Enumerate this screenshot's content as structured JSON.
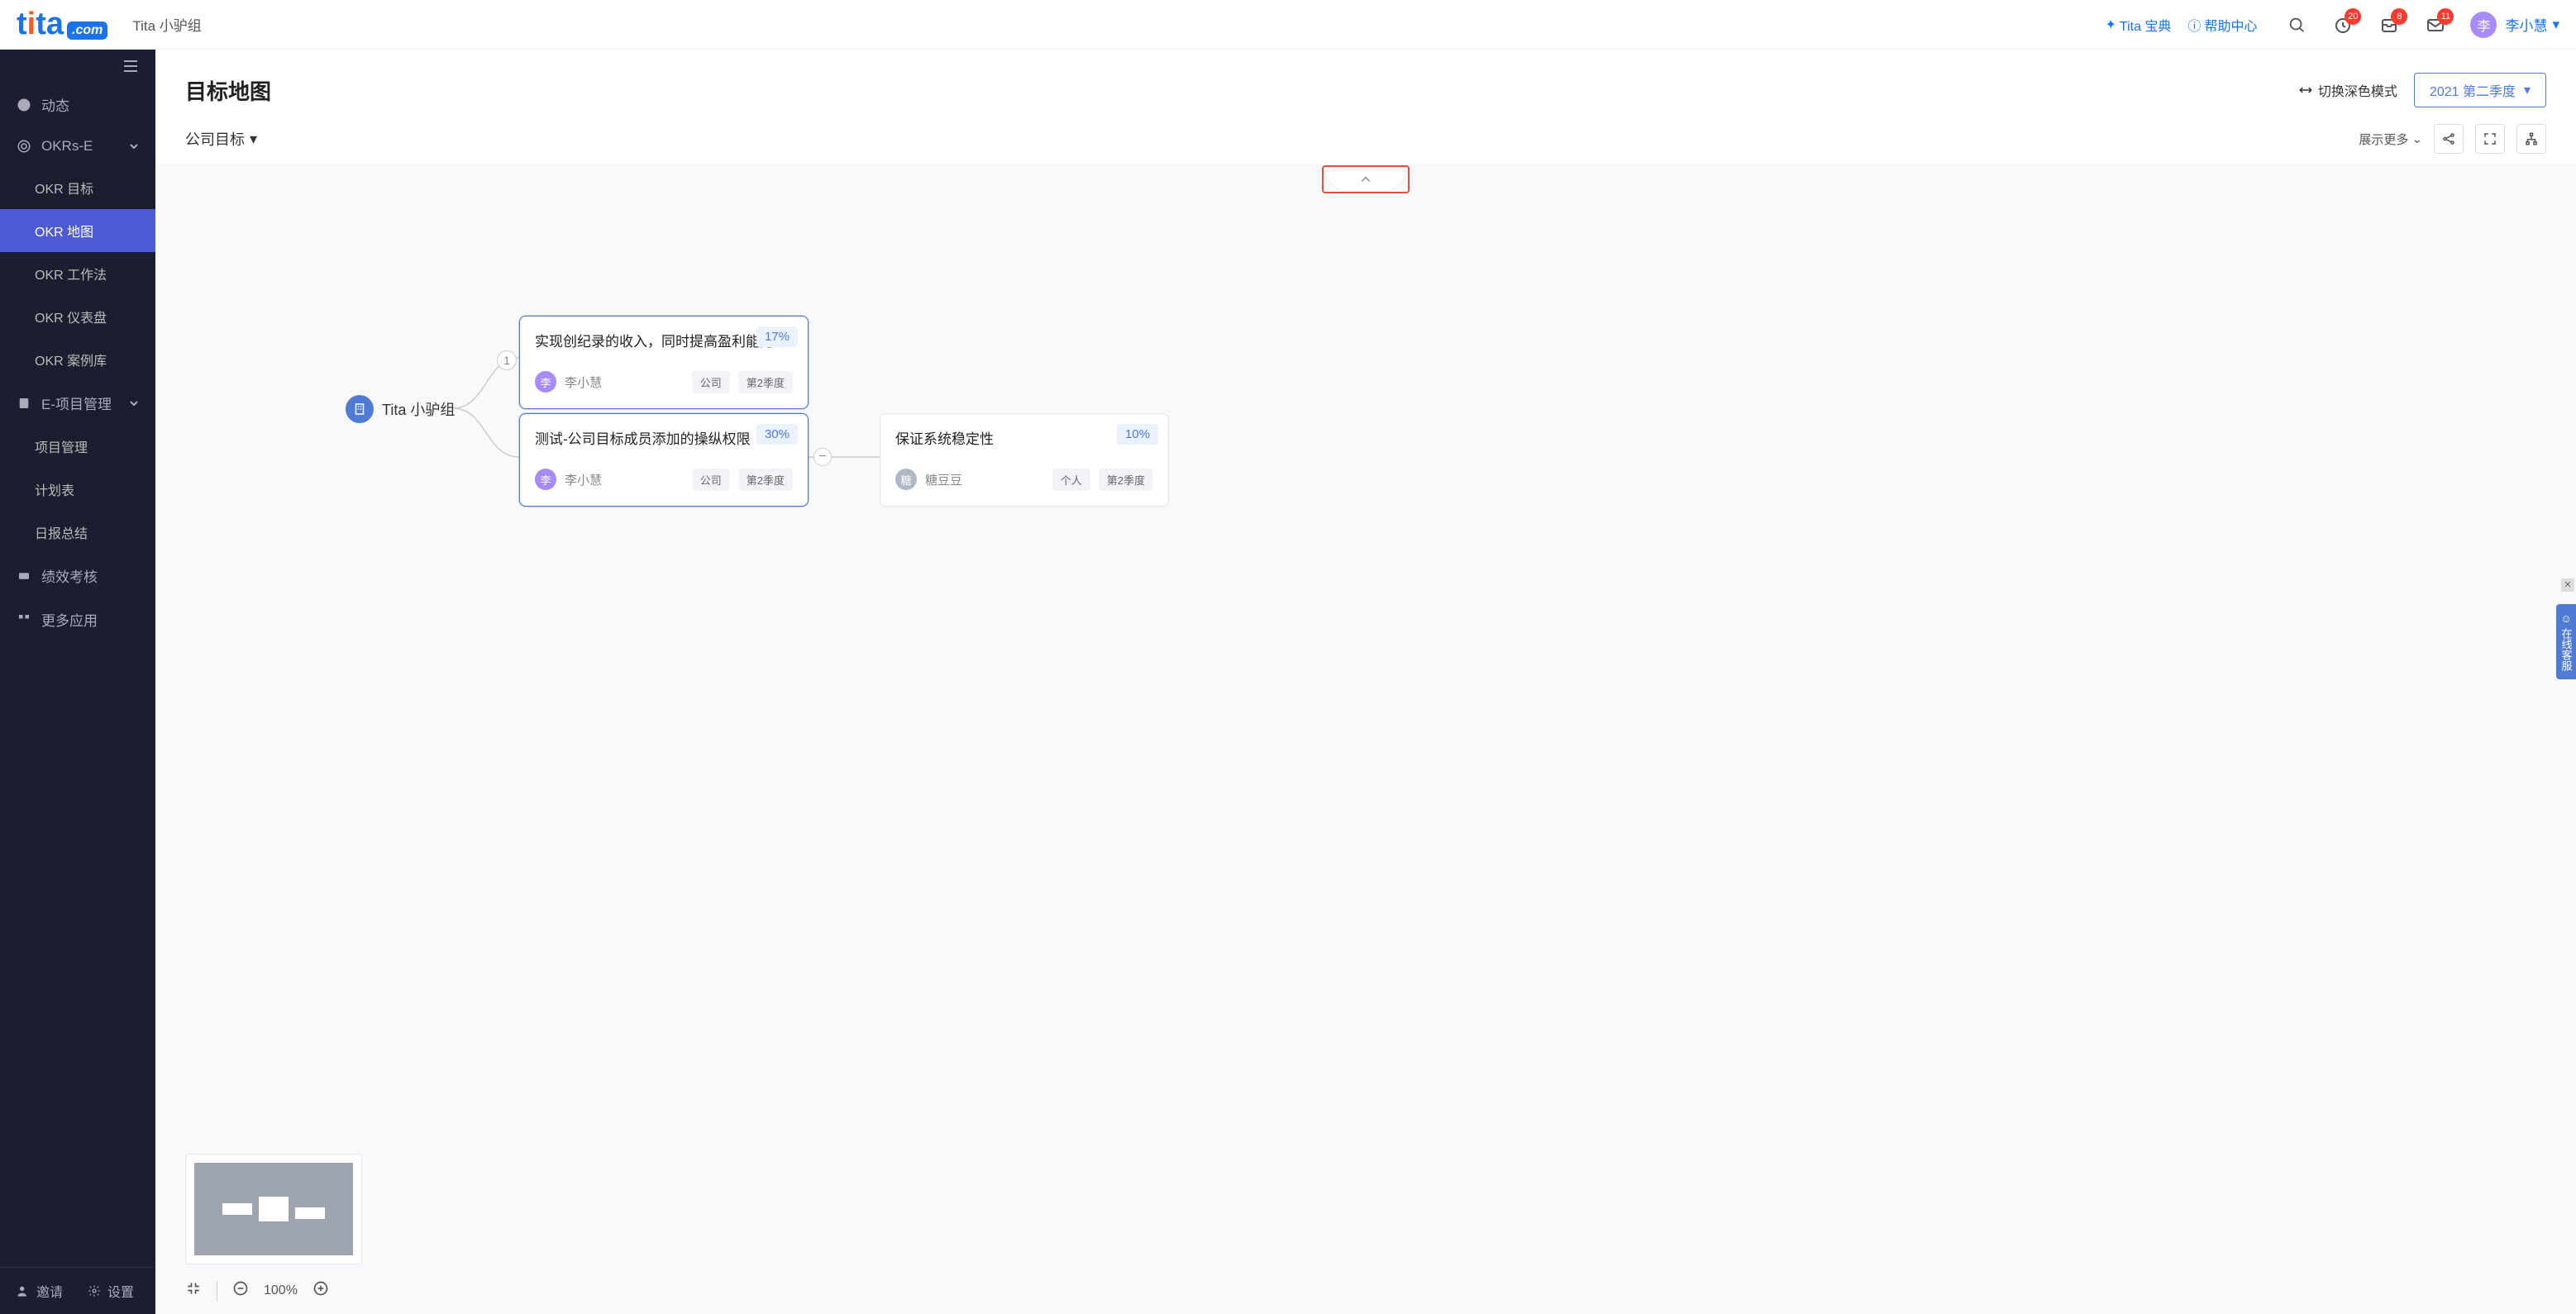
{
  "header": {
    "logo_parts": {
      "t": "t",
      "i": "i",
      "ta": "ta",
      "com": ".com"
    },
    "app_name": "Tita 小驴组",
    "links": {
      "baodian": "Tita 宝典",
      "help": "帮助中心"
    },
    "badges": {
      "reminder": "20",
      "inbox": "8",
      "mail": "11"
    },
    "avatar_char": "李",
    "user_name": "李小慧"
  },
  "sidebar": {
    "items": [
      {
        "label": "动态"
      },
      {
        "label": "OKRs-E"
      },
      {
        "label": "E-项目管理"
      },
      {
        "label": "绩效考核"
      },
      {
        "label": "更多应用"
      }
    ],
    "okrs_children": [
      {
        "label": "OKR 目标"
      },
      {
        "label": "OKR 地图"
      },
      {
        "label": "OKR 工作法"
      },
      {
        "label": "OKR 仪表盘"
      },
      {
        "label": "OKR 案例库"
      }
    ],
    "proj_children": [
      {
        "label": "项目管理"
      },
      {
        "label": "计划表"
      },
      {
        "label": "日报总结"
      }
    ],
    "bottom": {
      "invite": "邀请",
      "settings": "设置"
    }
  },
  "page": {
    "title": "目标地图",
    "dark_mode": "切换深色模式",
    "quarter": "2021 第二季度",
    "goal_dropdown": "公司目标",
    "show_more": "展示更多",
    "zoom": "100%"
  },
  "map": {
    "root": {
      "label": "Tita 小驴组"
    },
    "count": "1",
    "cards": [
      {
        "title": "实现创纪录的收入，同时提高盈利能力",
        "progress": "17%",
        "owner_char": "李",
        "owner": "李小慧",
        "avatar_style": "purple",
        "scope": "公司",
        "period": "第2季度",
        "selected": true
      },
      {
        "title": "测试-公司目标成员添加的操纵权限",
        "progress": "30%",
        "owner_char": "李",
        "owner": "李小慧",
        "avatar_style": "purple",
        "scope": "公司",
        "period": "第2季度",
        "selected": true
      },
      {
        "title": "保证系统稳定性",
        "progress": "10%",
        "owner_char": "糖",
        "owner": "糖豆豆",
        "avatar_style": "gray",
        "scope": "个人",
        "period": "第2季度",
        "selected": false
      }
    ]
  },
  "support": "在线客服"
}
